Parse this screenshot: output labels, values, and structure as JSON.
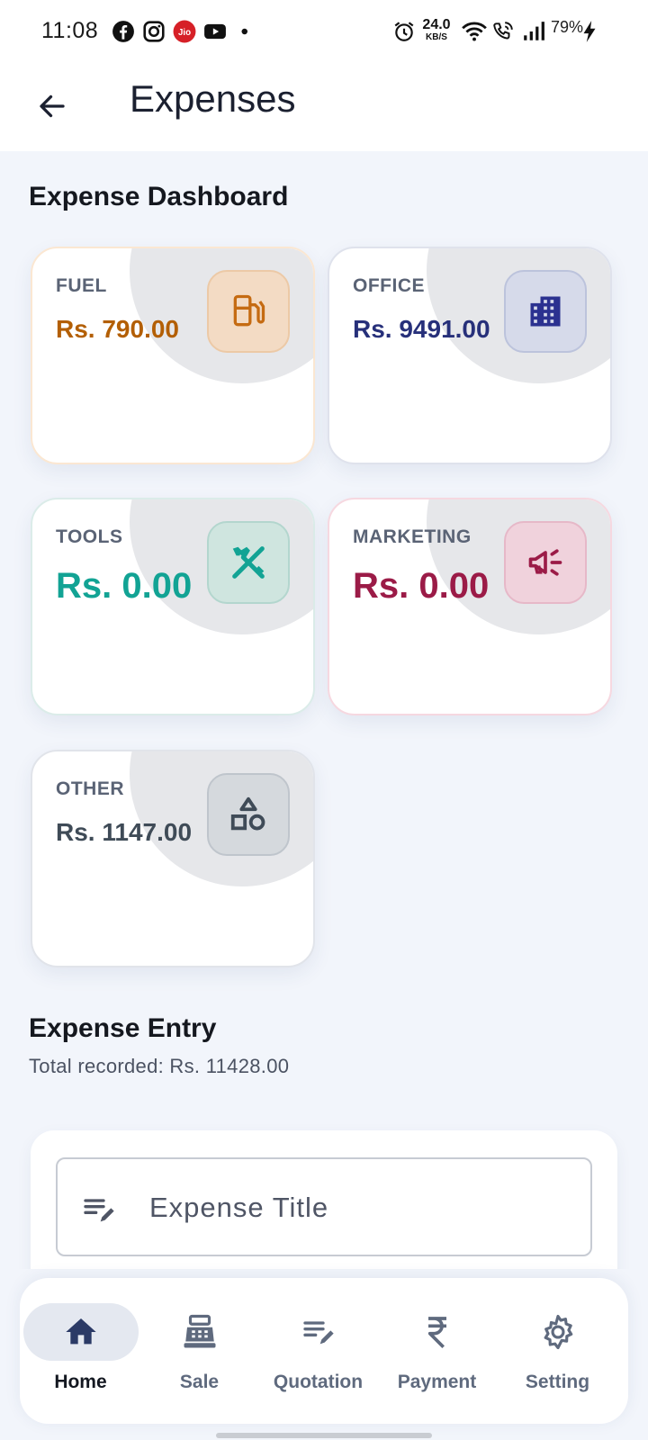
{
  "status_bar": {
    "time": "11:08",
    "net_speed_value": "24.0",
    "net_speed_unit": "KB/S",
    "battery": "79%",
    "carrier_badge": "Jio"
  },
  "app_bar": {
    "title": "Expenses"
  },
  "dashboard": {
    "title": "Expense Dashboard",
    "cards": [
      {
        "label": "FUEL",
        "value": "Rs. 790.00",
        "icon": "fuel-pump-icon",
        "accent": "#b35f05"
      },
      {
        "label": "OFFICE",
        "value": "Rs. 9491.00",
        "icon": "office-building-icon",
        "accent": "#27307a"
      },
      {
        "label": "TOOLS",
        "value": "Rs. 0.00",
        "icon": "tools-icon",
        "accent": "#12a394"
      },
      {
        "label": "MARKETING",
        "value": "Rs. 0.00",
        "icon": "megaphone-icon",
        "accent": "#9b1b47"
      },
      {
        "label": "OTHER",
        "value": "Rs. 1147.00",
        "icon": "shapes-icon",
        "accent": "#3f4b57"
      }
    ]
  },
  "entry": {
    "title": "Expense Entry",
    "total": "Total recorded: Rs. 11428.00",
    "title_placeholder": "Expense Title"
  },
  "bottom_nav": {
    "items": [
      {
        "label": "Home",
        "icon": "home-icon",
        "active": true
      },
      {
        "label": "Sale",
        "icon": "cash-register-icon",
        "active": false
      },
      {
        "label": "Quotation",
        "icon": "edit-notes-icon",
        "active": false
      },
      {
        "label": "Payment",
        "icon": "rupee-icon",
        "active": false
      },
      {
        "label": "Setting",
        "icon": "gear-icon",
        "active": false
      }
    ]
  }
}
